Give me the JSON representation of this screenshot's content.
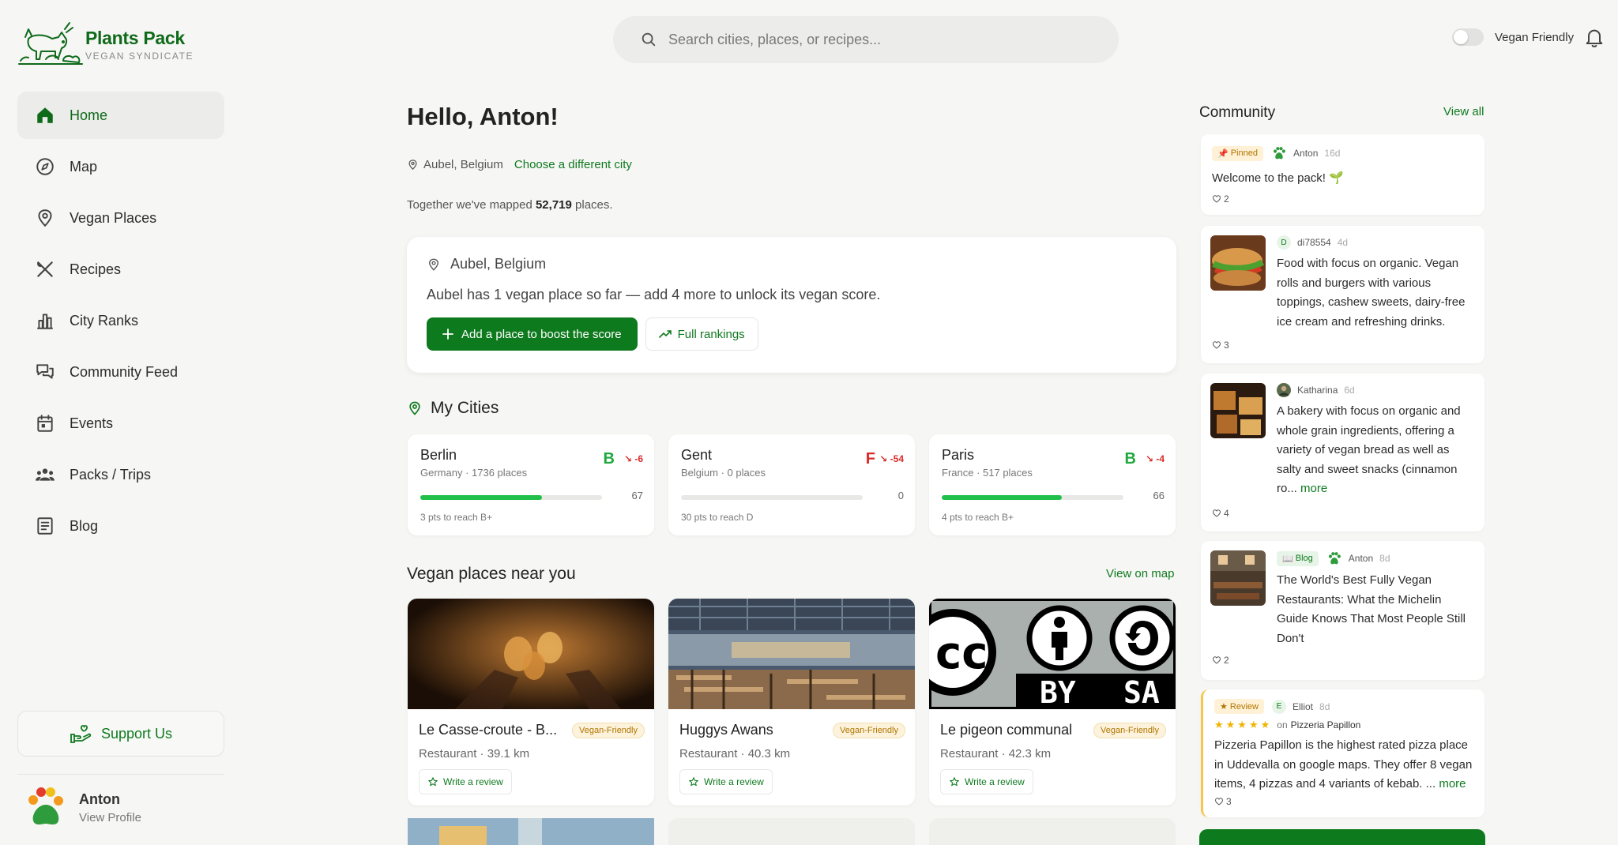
{
  "brand": {
    "title": "Plants Pack",
    "subtitle": "VEGAN SYNDICATE"
  },
  "search": {
    "placeholder": "Search cities, places, or recipes..."
  },
  "header": {
    "vegan_friendly_label": "Vegan Friendly",
    "vegan_friendly_on": false
  },
  "sidebar": {
    "items": [
      {
        "label": "Home",
        "icon": "home-icon",
        "active": true
      },
      {
        "label": "Map",
        "icon": "compass-icon"
      },
      {
        "label": "Vegan Places",
        "icon": "location-pin-icon"
      },
      {
        "label": "Recipes",
        "icon": "utensils-icon"
      },
      {
        "label": "City Ranks",
        "icon": "bar-chart-icon"
      },
      {
        "label": "Community Feed",
        "icon": "chat-bubbles-icon"
      },
      {
        "label": "Events",
        "icon": "calendar-icon"
      },
      {
        "label": "Packs / Trips",
        "icon": "group-icon"
      },
      {
        "label": "Blog",
        "icon": "article-icon"
      }
    ],
    "support_label": "Support Us",
    "profile": {
      "name": "Anton",
      "link": "View Profile"
    }
  },
  "main": {
    "greeting": "Hello, Anton!",
    "location": "Aubel, Belgium",
    "choose_city": "Choose a different city",
    "mapped_prefix": "Together we've mapped",
    "mapped_count": "52,719",
    "mapped_suffix": "places.",
    "score_card": {
      "location": "Aubel, Belgium",
      "message": "Aubel has 1 vegan place so far — add 4 more to unlock its vegan score.",
      "add_button": "Add a place to boost the score",
      "rankings_button": "Full rankings"
    },
    "my_cities_title": "My Cities",
    "cities": [
      {
        "name": "Berlin",
        "meta": "Germany · 1736 places",
        "grade": "B",
        "grade_color": "#1fa83e",
        "delta": "-6",
        "score": "67",
        "progress": 0.67,
        "next": "3 pts to reach B+"
      },
      {
        "name": "Gent",
        "meta": "Belgium · 0 places",
        "grade": "F",
        "grade_color": "#d92b2b",
        "delta": "-54",
        "score": "0",
        "progress": 0,
        "next": "30 pts to reach D"
      },
      {
        "name": "Paris",
        "meta": "France · 517 places",
        "grade": "B",
        "grade_color": "#1fa83e",
        "delta": "-4",
        "score": "66",
        "progress": 0.66,
        "next": "4 pts to reach B+"
      }
    ],
    "near_title": "Vegan places near you",
    "view_on_map": "View on map",
    "places": [
      {
        "name": "Le Casse-croute - B...",
        "badge": "Vegan-Friendly",
        "type": "Restaurant · 39.1 km",
        "review": "Write a review"
      },
      {
        "name": "Huggys Awans",
        "badge": "Vegan-Friendly",
        "type": "Restaurant · 40.3 km",
        "review": "Write a review"
      },
      {
        "name": "Le pigeon communal",
        "badge": "Vegan-Friendly",
        "type": "Restaurant · 42.3 km",
        "review": "Write a review",
        "license_cc": "cc",
        "license_by": "BY",
        "license_sa": "SA"
      }
    ]
  },
  "community": {
    "title": "Community",
    "view_all": "View all",
    "posts": [
      {
        "tag": "Pinned",
        "author": "Anton",
        "time": "16d",
        "text": "Welcome to the pack! 🌱",
        "likes": "2"
      },
      {
        "author_initial": "D",
        "author": "di78554",
        "time": "4d",
        "text": "Food with focus on organic. Vegan rolls and burgers with various toppings, cashew sweets, dairy-free ice cream and refreshing drinks.",
        "likes": "3"
      },
      {
        "author": "Katharina",
        "time": "6d",
        "text": "A bakery with focus on organic and whole grain ingredients, offering a variety of vegan bread as well as salty and sweet snacks (cinnamon ro...",
        "more": "more",
        "likes": "4"
      },
      {
        "tag": "Blog",
        "author": "Anton",
        "time": "8d",
        "text": "The World's Best Fully Vegan Restaurants: What the Michelin Guide Knows That Most People Still Don't",
        "likes": "2"
      },
      {
        "tag": "Review",
        "author_initial": "E",
        "author": "Elliot",
        "time": "8d",
        "stars": "★★★★★",
        "on_prefix": "on",
        "place": "Pizzeria Papillon",
        "text": "Pizzeria Papillon is the highest rated pizza place in Uddevalla on google maps. They offer 8 vegan items, 4 pizzas and 4 variants of kebab. ...",
        "more": "more",
        "likes": "3"
      }
    ]
  }
}
